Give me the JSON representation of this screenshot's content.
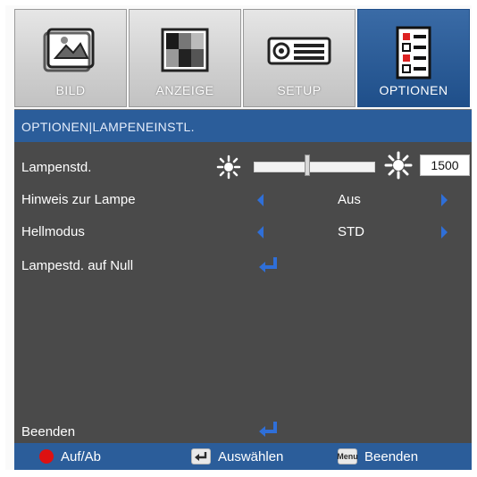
{
  "tabs": [
    {
      "label": "BILD",
      "icon": "picture-icon",
      "active": false
    },
    {
      "label": "ANZEIGE",
      "icon": "display-pattern-icon",
      "active": false
    },
    {
      "label": "SETUP",
      "icon": "projector-icon",
      "active": false
    },
    {
      "label": "OPTIONEN",
      "icon": "options-list-icon",
      "active": true
    }
  ],
  "breadcrumb": "OPTIONEN|LAMPENEINSTL.",
  "rows": {
    "lampenstd": {
      "label": "Lampenstd.",
      "value": "1500",
      "slider_fraction": 0.45
    },
    "hinweis": {
      "label": "Hinweis zur Lampe",
      "value": "Aus"
    },
    "hellmodus": {
      "label": "Hellmodus",
      "value": "STD"
    },
    "reset": {
      "label": "Lampestd. auf Null"
    },
    "beenden": {
      "label": "Beenden"
    }
  },
  "footer": {
    "updown": "Auf/Ab",
    "select": "Auswählen",
    "menu_key": "Menu",
    "exit": "Beenden"
  },
  "colors": {
    "accent_blue": "#2b5d9a",
    "arrow_blue": "#2f6fd8",
    "panel_gray": "#4a4a4a",
    "updown_red": "#dd1111"
  }
}
